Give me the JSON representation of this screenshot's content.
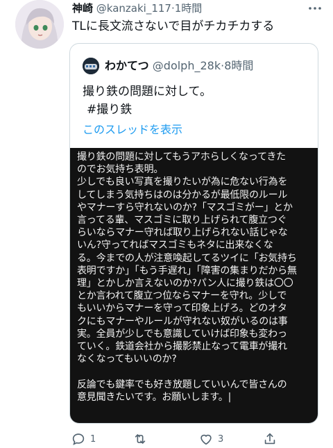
{
  "tweet": {
    "display_name": "神崎",
    "handle": "@kanzaki_117",
    "separator": "·",
    "time": "1時間",
    "text": "TLに長文流さないで目がチカチカする"
  },
  "quoted": {
    "display_name": "わかてつ",
    "handle": "@dolph_28k",
    "separator": "·",
    "time": "8時間",
    "text_line1": "撮り鉄の問題に対して。",
    "text_line2": "#撮り鉄",
    "show_thread": "このスレッドを表示",
    "image_text": "撮り鉄の問題に対してもうアホらしくなってきた\nのでお気持ち表明。\n少しでも良い写真を撮りたいが為に危ない行為を\nしてしまう気持ちはのは分かるが最低限のルール\nやマナーすら守れないのか?「マスゴミがー」とか\n言ってる輩、マスゴミに取り上げられて腹立つぐ\nらいならマナー守れば取り上げられない話じゃな\nいん?守ってればマスゴミもネタに出来なくな\nる。今までの人が注意喚起してるツイに「お気持ち\n表明ですか」「もう手遅れ」「障害の集まりだから無\n理」とかしか言えないのか?パン人に撮り鉄は〇〇\nとか言われて腹立つ位ならマナーを守れ。少しで\nもいいからマナーを守って印象上げろ。どのオタ\nクにもマナーやルールが守れない奴がいるのは事\n実。全員が少しでも意識していけば印象も変わっ\nていく。鉄道会社から撮影禁止なって電車が撮れ\nなくなってもいいのか?\n\n反論でも鍵率でも好き放題していいんで皆さんの\n意見聞きたいです。お願いします。|"
  },
  "actions": {
    "reply_count": "1",
    "retweet_count": "",
    "like_count": "3"
  },
  "colors": {
    "link": "#1d9bf0",
    "secondary": "#536471",
    "media_bg": "#121212"
  },
  "icons": [
    "more-icon",
    "reply-icon",
    "retweet-icon",
    "like-icon",
    "share-icon"
  ]
}
